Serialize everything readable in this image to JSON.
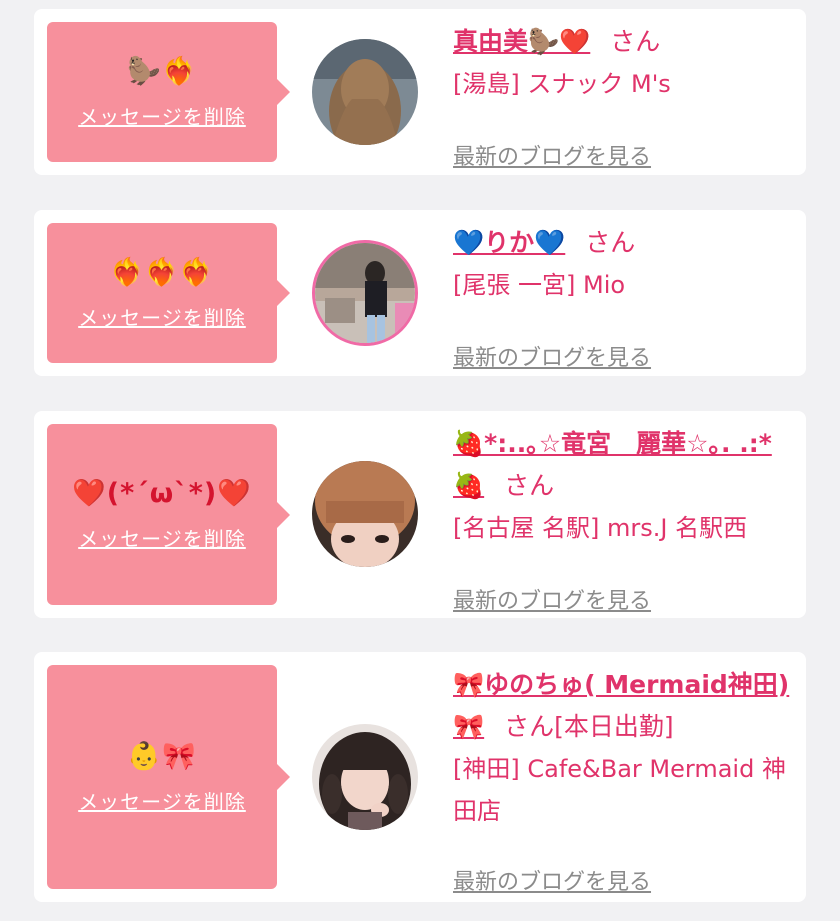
{
  "messages": [
    {
      "emojis": "🦫❤️‍🔥",
      "delete_label": "メッセージを削除",
      "name": "真由美🦫❤️",
      "honorific": "さん",
      "extra": "",
      "shop": "[湯島] スナック M's",
      "blog_label": "最新のブログを見る"
    },
    {
      "emojis": "❤️‍🔥❤️‍🔥❤️‍🔥",
      "delete_label": "メッセージを削除",
      "name": "💙りか💙",
      "honorific": "さん",
      "extra": "",
      "shop": "[尾張 一宮] Mio",
      "blog_label": "最新のブログを見る"
    },
    {
      "emojis": "❤️(*´ω`*)❤️",
      "delete_label": "メッセージを削除",
      "name": "🍓*:..｡☆竜宮　麗華☆｡. .:*🍓",
      "honorific": "さん",
      "extra": "",
      "shop": "[名古屋 名駅] mrs.J 名駅西",
      "blog_label": "最新のブログを見る"
    },
    {
      "emojis": "👶🎀",
      "delete_label": "メッセージを削除",
      "name": "🎀ゆのちゅ( Mermaid神田)🎀",
      "honorific": "さん",
      "extra": "[本日出勤]",
      "shop": "[神田] Cafe&Bar Mermaid 神田店",
      "blog_label": "最新のブログを見る"
    }
  ],
  "colors": {
    "accent": "#e0336a",
    "bubble": "#f7909c",
    "link_gray": "#8b8b8b",
    "background": "#f1f1f3"
  }
}
